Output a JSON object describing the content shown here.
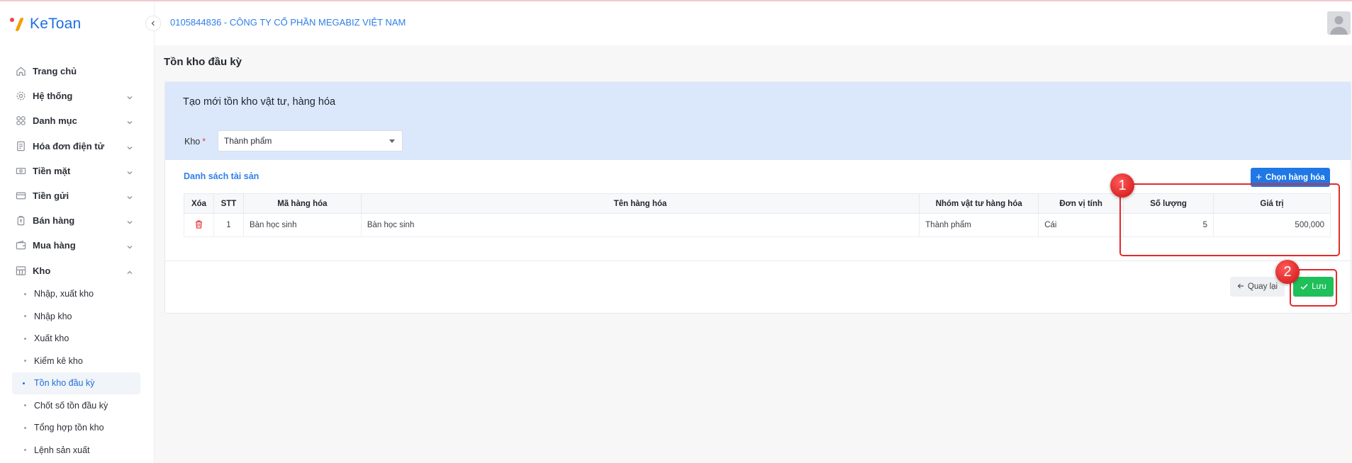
{
  "app": {
    "logo_text": "KeToan"
  },
  "header": {
    "company": "0105844836 - CÔNG TY CỔ PHẦN MEGABIZ VIỆT NAM"
  },
  "sidebar": {
    "items": [
      {
        "label": "Trang chủ",
        "icon": "home-icon",
        "chevron": false
      },
      {
        "label": "Hệ thống",
        "icon": "gear-icon",
        "chevron": true
      },
      {
        "label": "Danh mục",
        "icon": "grid-icon",
        "chevron": true
      },
      {
        "label": "Hóa đơn điện tử",
        "icon": "invoice-icon",
        "chevron": true
      },
      {
        "label": "Tiền mặt",
        "icon": "cash-icon",
        "chevron": true
      },
      {
        "label": "Tiền gửi",
        "icon": "bank-card-icon",
        "chevron": true
      },
      {
        "label": "Bán hàng",
        "icon": "sales-icon",
        "chevron": true
      },
      {
        "label": "Mua hàng",
        "icon": "wallet-icon",
        "chevron": true
      },
      {
        "label": "Kho",
        "icon": "warehouse-icon",
        "chevron": true,
        "expanded": true
      }
    ],
    "sub_items": [
      "Nhập, xuất kho",
      "Nhập kho",
      "Xuất kho",
      "Kiểm kê kho",
      "Tồn kho đầu kỳ",
      "Chốt số tồn đầu kỳ",
      "Tổng hợp tồn kho",
      "Lệnh sản xuất"
    ],
    "active_sub": "Tồn kho đầu kỳ"
  },
  "page": {
    "title": "Tồn kho đầu kỳ"
  },
  "form": {
    "title": "Tạo mới tồn kho vật tư, hàng hóa",
    "warehouse_label": "Kho",
    "warehouse_value": "Thành phẩm"
  },
  "list": {
    "title": "Danh sách tài sản",
    "choose_button": "Chọn hàng hóa",
    "columns": [
      "Xóa",
      "STT",
      "Mã hàng hóa",
      "Tên hàng hóa",
      "Nhóm vật tư hàng hóa",
      "Đơn vị tính",
      "Số lượng",
      "Giá trị"
    ],
    "rows": [
      {
        "stt": "1",
        "code": "Bàn học sinh",
        "name": "Bàn học sinh",
        "group": "Thành phẩm",
        "unit": "Cái",
        "qty": "5",
        "value": "500,000"
      }
    ]
  },
  "actions": {
    "back": "Quay lại",
    "save": "Lưu"
  },
  "annotations": [
    "1",
    "2"
  ],
  "colors": {
    "accent": "#1f78e6",
    "save": "#1fbf5a",
    "annotation": "#e12b2b",
    "form_bg": "#dbe8fb"
  }
}
